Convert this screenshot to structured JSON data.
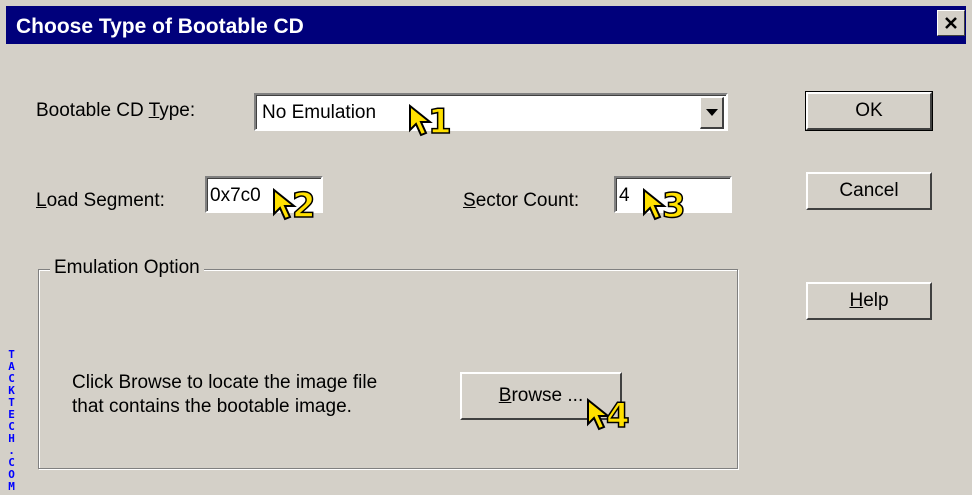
{
  "window": {
    "title": "Choose Type of Bootable CD",
    "close_glyph": "✕"
  },
  "cd_type": {
    "label": "Bootable CD Type:",
    "value": "No Emulation"
  },
  "load_segment": {
    "label": "Load Segment:",
    "value": "0x7c0"
  },
  "sector_count": {
    "label": "Sector Count:",
    "value": "4"
  },
  "emulation": {
    "legend": "Emulation Option",
    "description_line1": "Click Browse to locate the image file",
    "description_line2": "that contains the bootable image.",
    "browse_label": "Browse ..."
  },
  "buttons": {
    "ok": "OK",
    "cancel": "Cancel",
    "help": "Help"
  },
  "callouts": [
    "1",
    "2",
    "3",
    "4"
  ],
  "watermark": "TACKTECH.COM",
  "colors": {
    "titlebar": "#00007b",
    "dialog": "#d4d0c8",
    "callout": "#ffe000"
  }
}
